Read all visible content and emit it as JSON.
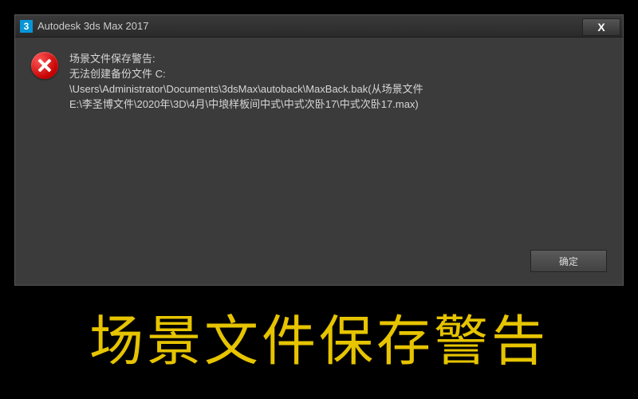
{
  "window": {
    "title": "Autodesk 3ds Max 2017",
    "app_icon_glyph": "3",
    "close_label": "X"
  },
  "message": {
    "line1": "场景文件保存警告:",
    "line2": "无法创建备份文件 C:",
    "line3": "\\Users\\Administrator\\Documents\\3dsMax\\autoback\\MaxBack.bak(从场景文件",
    "line4": "E:\\李圣博文件\\2020年\\3D\\4月\\中埌样板间中式\\中式次卧17\\中式次卧17.max)"
  },
  "buttons": {
    "ok": "确定"
  },
  "caption": "场景文件保存警告",
  "icons": {
    "error": "error-icon"
  }
}
